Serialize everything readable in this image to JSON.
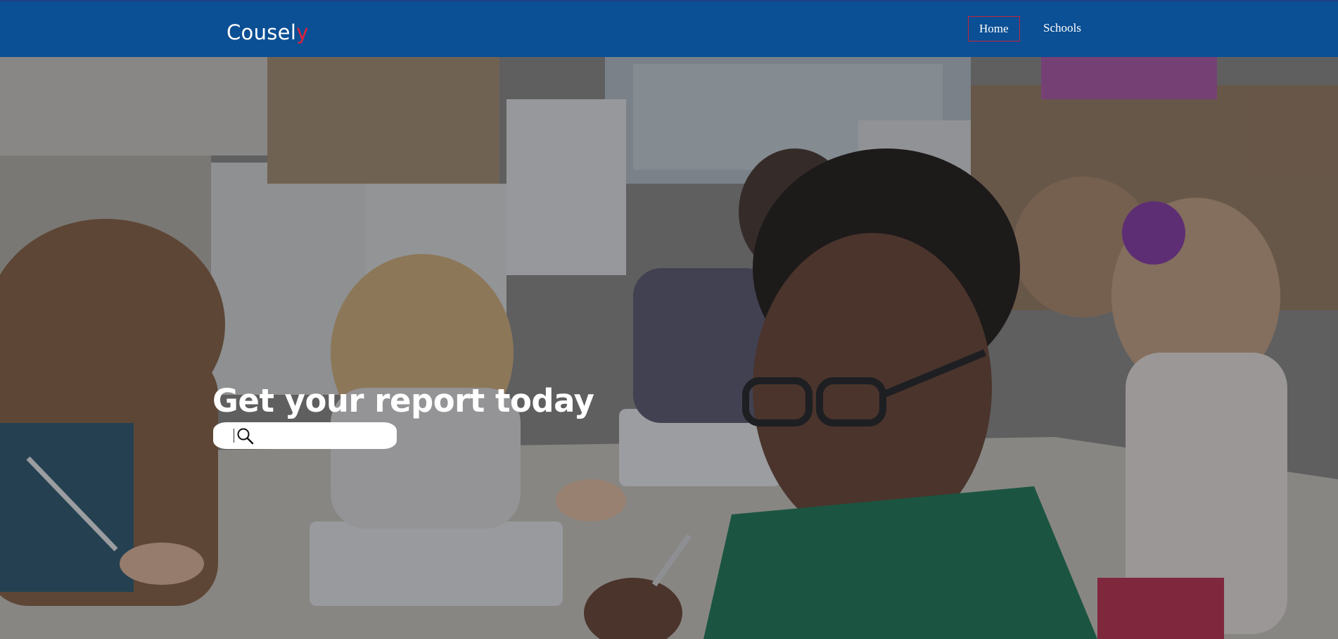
{
  "brand": {
    "name_main": "Cousel",
    "name_accent": "y",
    "accent_color": "#e0203a"
  },
  "nav": {
    "background": "#0b4f94",
    "items": [
      {
        "label": "Home",
        "active": true
      },
      {
        "label": "Schools",
        "active": false
      }
    ]
  },
  "hero": {
    "title": "Get your report today",
    "image_icon": "classroom-photo",
    "search": {
      "placeholder": "",
      "value": "",
      "icon": "search-icon"
    }
  }
}
